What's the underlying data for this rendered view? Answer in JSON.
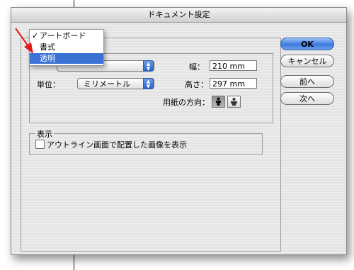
{
  "dialog": {
    "title": "ドキュメント設定"
  },
  "menu": {
    "items": [
      {
        "label": "アートボード",
        "checked": true
      },
      {
        "label": "書式",
        "checked": false
      },
      {
        "label": "透明",
        "checked": false,
        "highlighted": true
      }
    ],
    "check_glyph": "✓"
  },
  "size_group": {
    "units_label": "単位：",
    "units_value": "ミリメートル",
    "width_label": "幅：",
    "width_value": "210 mm",
    "height_label": "高さ：",
    "height_value": "297 mm",
    "orientation_label": "用紙の方向："
  },
  "display_group": {
    "legend": "表示",
    "checkbox_label": "アウトライン画面で配置した画像を表示",
    "checkbox_checked": false
  },
  "buttons": {
    "ok": "OK",
    "cancel": "キャンセル",
    "prev": "前へ",
    "next": "次へ"
  },
  "colors": {
    "accent": "#3a72d6",
    "annotation_arrow": "#e8171d"
  },
  "icons": {
    "orientation_portrait": "portrait-orientation-icon",
    "orientation_landscape": "landscape-orientation-icon",
    "popup_arrows": "popup-arrows-icon",
    "annotation": "red-arrow-icon"
  }
}
